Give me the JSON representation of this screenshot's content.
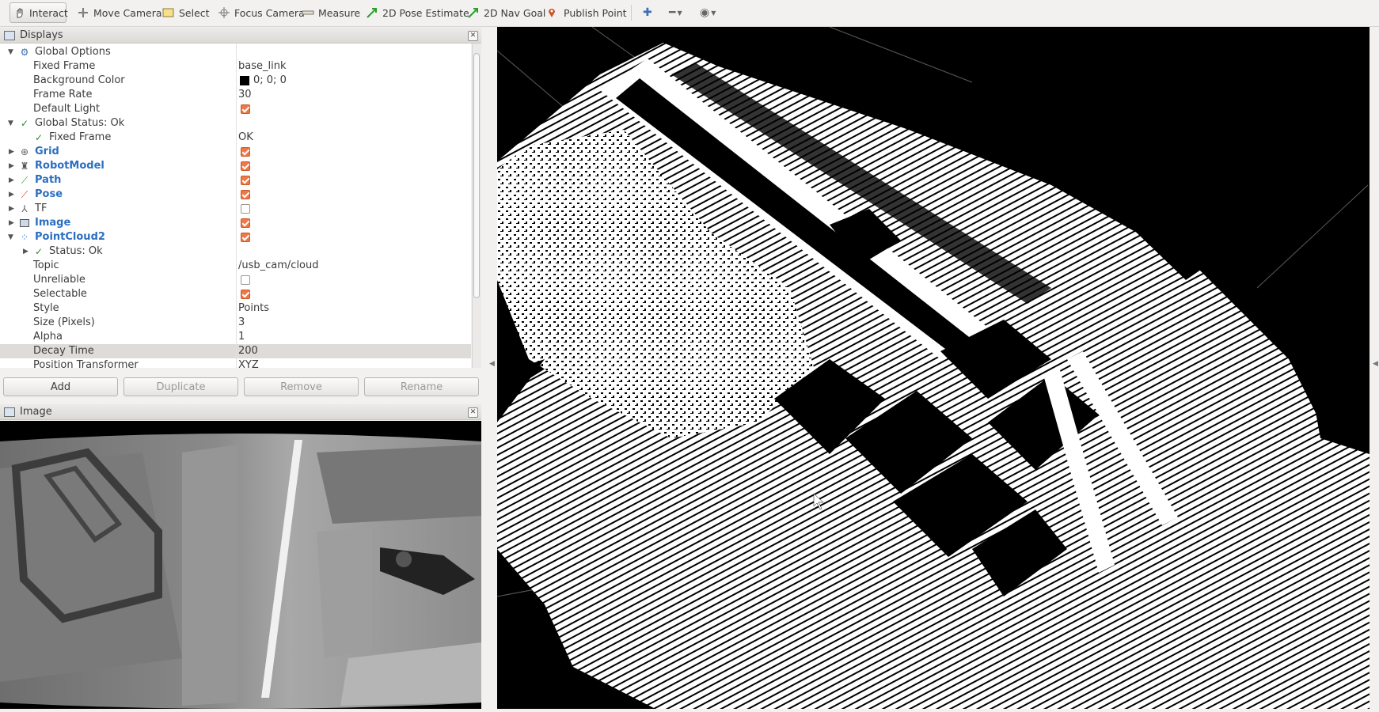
{
  "toolbar": {
    "tools": [
      {
        "label": "Interact",
        "icon": "hand-icon"
      },
      {
        "label": "Move Camera",
        "icon": "move-camera-icon"
      },
      {
        "label": "Select",
        "icon": "select-icon"
      },
      {
        "label": "Focus Camera",
        "icon": "focus-camera-icon"
      },
      {
        "label": "Measure",
        "icon": "measure-icon"
      },
      {
        "label": "2D Pose Estimate",
        "icon": "pose-arrow-icon"
      },
      {
        "label": "2D Nav Goal",
        "icon": "nav-goal-arrow-icon"
      },
      {
        "label": "Publish Point",
        "icon": "map-pin-icon"
      }
    ]
  },
  "displays_panel": {
    "title": "Displays",
    "rows": [
      {
        "label": "Global Options",
        "value": ""
      },
      {
        "label": "Fixed Frame",
        "value": "base_link"
      },
      {
        "label": "Background Color",
        "value": "0; 0; 0"
      },
      {
        "label": "Frame Rate",
        "value": "30"
      },
      {
        "label": "Default Light",
        "value": ""
      },
      {
        "label": "Global Status: Ok",
        "value": ""
      },
      {
        "label": "Fixed Frame",
        "value": "OK"
      },
      {
        "label": "Grid",
        "value": ""
      },
      {
        "label": "RobotModel",
        "value": ""
      },
      {
        "label": "Path",
        "value": ""
      },
      {
        "label": "Pose",
        "value": ""
      },
      {
        "label": "TF",
        "value": ""
      },
      {
        "label": "Image",
        "value": ""
      },
      {
        "label": "PointCloud2",
        "value": ""
      },
      {
        "label": "Status: Ok",
        "value": ""
      },
      {
        "label": "Topic",
        "value": "/usb_cam/cloud"
      },
      {
        "label": "Unreliable",
        "value": ""
      },
      {
        "label": "Selectable",
        "value": ""
      },
      {
        "label": "Style",
        "value": "Points"
      },
      {
        "label": "Size (Pixels)",
        "value": "3"
      },
      {
        "label": "Alpha",
        "value": "1"
      },
      {
        "label": "Decay Time",
        "value": "200"
      },
      {
        "label": "Position Transformer",
        "value": "XYZ"
      }
    ],
    "buttons": [
      "Add",
      "Duplicate",
      "Remove",
      "Rename"
    ]
  },
  "image_panel": {
    "title": "Image"
  },
  "colors": {
    "checkbox_on": "#f07746",
    "display_link": "#2c6fc0",
    "viewport_bg": "#000000"
  }
}
